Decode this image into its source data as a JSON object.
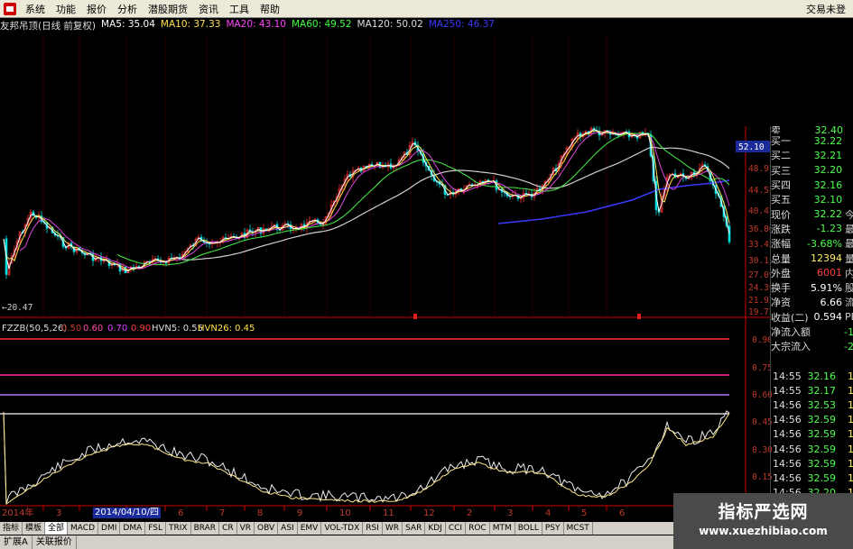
{
  "menu": {
    "items": [
      "系统",
      "功能",
      "报价",
      "分析",
      "潜股期货",
      "资讯",
      "工具",
      "帮助"
    ],
    "right_text": "交易未登"
  },
  "stock_info": {
    "name": "友邦吊顶(日线 前复权)",
    "ma5": "MA5: 35.04",
    "ma10": "MA10: 37.33",
    "ma20": "MA20: 43.10",
    "ma60": "MA60: 49.52",
    "ma120": "MA120: 50.02",
    "ma250": "MA250: 46.37",
    "low_marker": "←20.47"
  },
  "colors": {
    "ma5": "#ffffff",
    "ma10": "#ffe14a",
    "ma20": "#ff44ff",
    "ma60": "#44ff44",
    "ma120": "#dddddd",
    "ma250": "#3a3aff",
    "up": "#ff3030",
    "down": "#00e0e0"
  },
  "price_axis": [
    "52.10",
    "48.97",
    "44.52",
    "40.47",
    "36.80",
    "33.45",
    "30.11",
    "27.09",
    "24.39",
    "21.95",
    "19.75"
  ],
  "indicator": {
    "name": "FZZB(50,5,26)",
    "levels": [
      "0.50",
      "0.60",
      "0.70",
      "0.90"
    ],
    "hvn5": "HVN5: 0.55",
    "hvn26": "HVN26: 0.45",
    "axis": [
      "0.90",
      "0.75",
      "0.60",
      "0.45",
      "0.30",
      "0.15"
    ]
  },
  "time_axis": {
    "year": "2014年",
    "labels": [
      "3",
      "4",
      "5",
      "6",
      "7",
      "8",
      "9",
      "10",
      "11",
      "12",
      "2",
      "3",
      "4",
      "5",
      "6"
    ],
    "selected_date": "2014/04/10/四"
  },
  "quote_panel": {
    "top_label": "卖",
    "top_value": "32.40",
    "rows": [
      {
        "k": "买一",
        "v": "32.22",
        "x": ""
      },
      {
        "k": "买二",
        "v": "32.21",
        "x": ""
      },
      {
        "k": "买三",
        "v": "32.20",
        "x": ""
      },
      {
        "k": "买四",
        "v": "32.16",
        "x": ""
      },
      {
        "k": "买五",
        "v": "32.10",
        "x": ""
      },
      {
        "k": "现价",
        "v": "32.22",
        "x": "今"
      },
      {
        "k": "涨跌",
        "v": "-1.23",
        "x": "最"
      },
      {
        "k": "涨幅",
        "v": "-3.68%",
        "x": "最"
      },
      {
        "k": "总量",
        "v": "12394",
        "x": "量"
      },
      {
        "k": "外盘",
        "v": "6001",
        "x": "内"
      },
      {
        "k": "换手",
        "v": "5.91%",
        "x": "股"
      },
      {
        "k": "净资",
        "v": "6.66",
        "x": "流"
      },
      {
        "k": "收益(二)",
        "v": "0.594",
        "x": "PE"
      },
      {
        "k": "净流入额",
        "v": "",
        "x": "-1"
      },
      {
        "k": "大宗流入",
        "v": "",
        "x": "-2"
      }
    ],
    "price_box": "52.10"
  },
  "ticks": [
    {
      "t": "14:55",
      "p": "32.16",
      "q": "1"
    },
    {
      "t": "14:55",
      "p": "32.17",
      "q": "1"
    },
    {
      "t": "14:56",
      "p": "32.53",
      "q": "1"
    },
    {
      "t": "14:56",
      "p": "32.59",
      "q": "1"
    },
    {
      "t": "14:56",
      "p": "32.59",
      "q": "1"
    },
    {
      "t": "14:56",
      "p": "32.59",
      "q": "1"
    },
    {
      "t": "14:56",
      "p": "32.59",
      "q": "1"
    },
    {
      "t": "14:56",
      "p": "32.59",
      "q": "1"
    },
    {
      "t": "14:56",
      "p": "32.20",
      "q": "1"
    },
    {
      "t": "14:56",
      "p": "32.20",
      "q": "1"
    }
  ],
  "indicator_tabs": [
    "指标",
    "模板",
    "全部",
    "MACD",
    "DMI",
    "DMA",
    "FSL",
    "TRIX",
    "BRAR",
    "CR",
    "VR",
    "OBV",
    "ASI",
    "EMV",
    "VOL-TDX",
    "RSI",
    "WR",
    "SAR",
    "KDJ",
    "CCI",
    "ROC",
    "MTM",
    "BOLL",
    "PSY",
    "MCST"
  ],
  "bottom_tabs": [
    "扩展A",
    "关联报价"
  ],
  "watermark": {
    "title": "指标严选网",
    "url": "www.xuezhibiao.com"
  }
}
